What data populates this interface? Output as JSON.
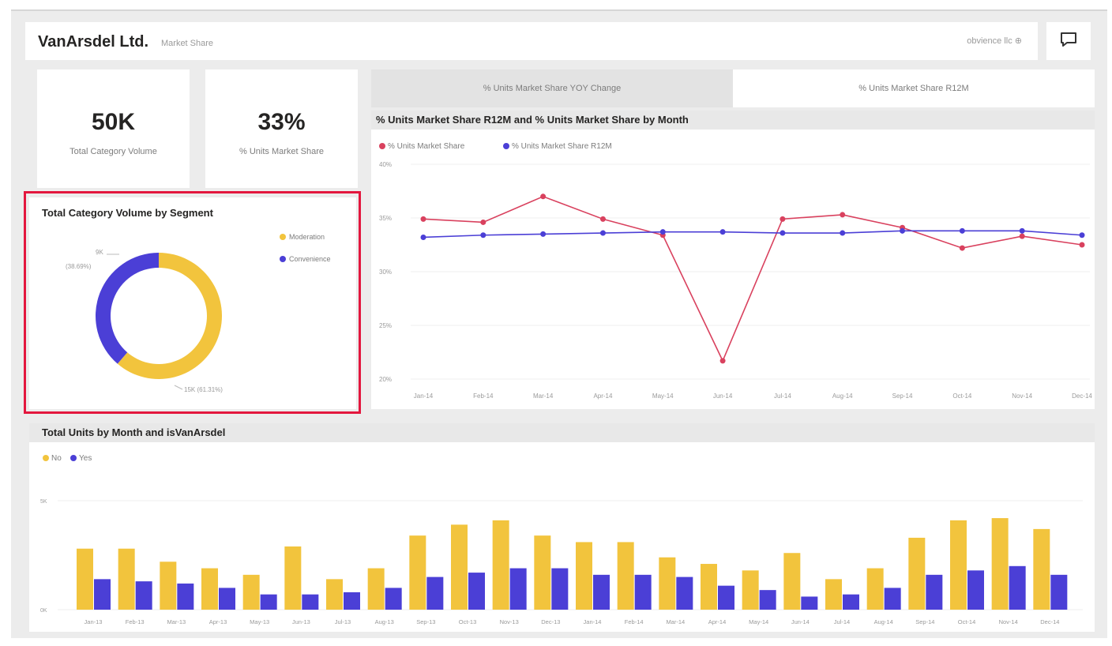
{
  "header": {
    "title": "VanArsdel Ltd.",
    "subtitle": "Market Share",
    "user": "obvience llc ⊕"
  },
  "kpis": [
    {
      "value": "50K",
      "label": "Total Category Volume"
    },
    {
      "value": "33%",
      "label": "% Units Market Share"
    }
  ],
  "tabs": [
    {
      "label": "% Units Market Share YOY Change",
      "active": false
    },
    {
      "label": "% Units Market Share R12M",
      "active": true
    }
  ],
  "icons": {
    "comment": "comment-icon"
  },
  "colors": {
    "yellow": "#f2c43d",
    "blue": "#4b3fd6",
    "red": "#d9415e",
    "highlight": "#e3173e"
  },
  "chart_data": [
    {
      "type": "pie",
      "title": "Total Category Volume by Segment",
      "legend": [
        "Moderation",
        "Convenience"
      ],
      "slices": [
        {
          "name": "Moderation",
          "value": 61.31,
          "label": "15K (61.31%)"
        },
        {
          "name": "Convenience",
          "value": 38.69,
          "label": "9K (38.69%)"
        }
      ],
      "label_lines": [
        "9K",
        "(38.69%)",
        "15K (61.31%)"
      ],
      "donut": true
    },
    {
      "type": "line",
      "title": "% Units Market Share R12M and % Units Market Share by Month",
      "legend_position": "top-left",
      "categories": [
        "Jan-14",
        "Feb-14",
        "Mar-14",
        "Apr-14",
        "May-14",
        "Jun-14",
        "Jul-14",
        "Aug-14",
        "Sep-14",
        "Oct-14",
        "Nov-14",
        "Dec-14"
      ],
      "series": [
        {
          "name": "% Units Market Share",
          "values": [
            34.9,
            34.6,
            37.0,
            34.9,
            33.4,
            21.7,
            34.9,
            35.3,
            34.1,
            32.2,
            33.3,
            32.5
          ]
        },
        {
          "name": "% Units Market Share R12M",
          "values": [
            33.2,
            33.4,
            33.5,
            33.6,
            33.7,
            33.7,
            33.6,
            33.6,
            33.8,
            33.8,
            33.8,
            33.4
          ]
        }
      ],
      "yticks": [
        "40%",
        "35%",
        "30%",
        "25%",
        "20%"
      ],
      "ylim": [
        20,
        40
      ]
    },
    {
      "type": "bar",
      "title": "Total Units by Month and isVanArsdel",
      "legend_position": "top-left",
      "categories": [
        "Jan-13",
        "Feb-13",
        "Mar-13",
        "Apr-13",
        "May-13",
        "Jun-13",
        "Jul-13",
        "Aug-13",
        "Sep-13",
        "Oct-13",
        "Nov-13",
        "Dec-13",
        "Jan-14",
        "Feb-14",
        "Mar-14",
        "Apr-14",
        "May-14",
        "Jun-14",
        "Jul-14",
        "Aug-14",
        "Sep-14",
        "Oct-14",
        "Nov-14",
        "Dec-14"
      ],
      "series": [
        {
          "name": "No",
          "values": [
            2.8,
            2.8,
            2.2,
            1.9,
            1.6,
            2.9,
            1.4,
            1.9,
            3.4,
            3.9,
            4.1,
            3.4,
            3.1,
            3.1,
            2.4,
            2.1,
            1.8,
            2.6,
            1.4,
            1.9,
            3.3,
            4.1,
            4.2,
            3.7
          ]
        },
        {
          "name": "Yes",
          "values": [
            1.4,
            1.3,
            1.2,
            1.0,
            0.7,
            0.7,
            0.8,
            1.0,
            1.5,
            1.7,
            1.9,
            1.9,
            1.6,
            1.6,
            1.5,
            1.1,
            0.9,
            0.6,
            0.7,
            1.0,
            1.6,
            1.8,
            2.0,
            1.6
          ]
        }
      ],
      "yticks": [
        "5K",
        "0K"
      ],
      "ylim": [
        0,
        5
      ]
    }
  ]
}
